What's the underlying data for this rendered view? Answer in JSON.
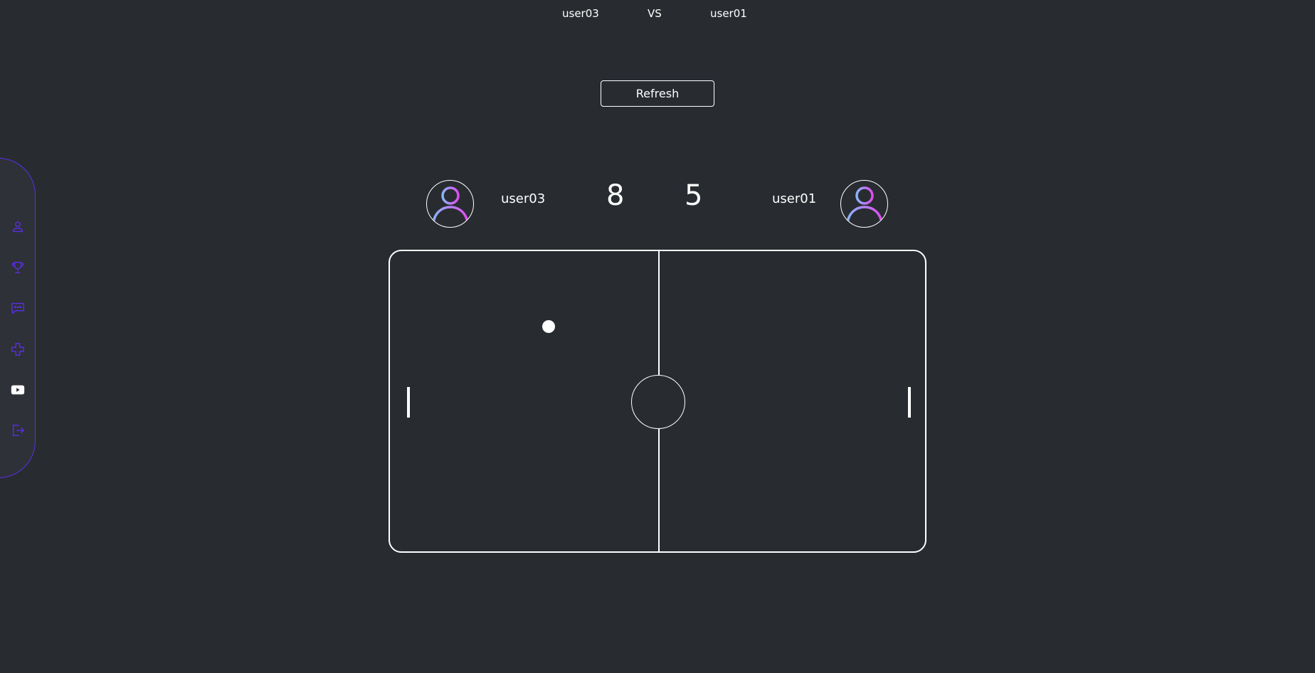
{
  "matchup": {
    "player_left": "user03",
    "vs": "VS",
    "player_right": "user01"
  },
  "refresh_label": "Refresh",
  "sidebar": {
    "accent_color": "#5b2ee6",
    "items": [
      {
        "icon": "user-icon"
      },
      {
        "icon": "trophy-icon"
      },
      {
        "icon": "chat-icon"
      },
      {
        "icon": "gamepad-icon"
      },
      {
        "icon": "play-video-icon"
      },
      {
        "icon": "logout-icon"
      }
    ]
  },
  "scoreboard": {
    "left": {
      "name": "user03",
      "score": "8"
    },
    "right": {
      "name": "user01",
      "score": "5"
    }
  },
  "colors": {
    "background": "#282c31",
    "field_lines": "#ffffff",
    "avatar_gradient_start": "#8ab4f8",
    "avatar_gradient_end": "#e04bf0"
  }
}
